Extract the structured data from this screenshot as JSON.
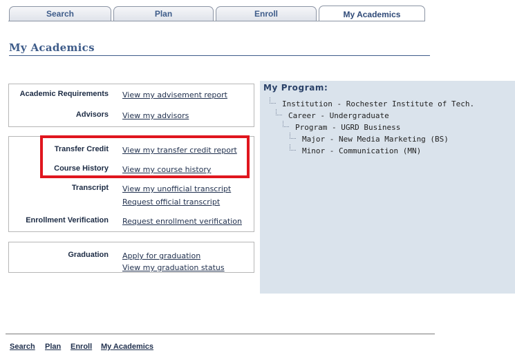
{
  "tabs": [
    {
      "label": "Search"
    },
    {
      "label": "Plan"
    },
    {
      "label": "Enroll"
    },
    {
      "label": "My Academics",
      "active": true
    }
  ],
  "page_title": "My Academics",
  "sections": {
    "academic_requirements": {
      "label": "Academic Requirements",
      "link": "View my advisement report"
    },
    "advisors": {
      "label": "Advisors",
      "link": "View my advisors"
    },
    "transfer_credit": {
      "label": "Transfer Credit",
      "link": "View my transfer credit report"
    },
    "course_history": {
      "label": "Course History",
      "link": "View my course history"
    },
    "transcript": {
      "label": "Transcript",
      "links": [
        "View my unofficial transcript",
        "Request official transcript"
      ]
    },
    "enrollment_verification": {
      "label": "Enrollment Verification",
      "link": "Request enrollment verification"
    },
    "graduation": {
      "label": "Graduation",
      "links": [
        "Apply for graduation",
        "View my graduation status"
      ]
    }
  },
  "program": {
    "title": "My Program:",
    "tree": [
      "Institution - Rochester Institute of Tech.",
      "Career - Undergraduate",
      "Program - UGRD Business",
      "Major - New Media Marketing (BS)",
      "Minor - Communication (MN)"
    ]
  },
  "footer_links": [
    "Search",
    "Plan",
    "Enroll",
    "My Academics"
  ],
  "colors": {
    "accent": "#3e5c8a",
    "highlight": "#e0161e",
    "panel": "#dae3ec"
  }
}
